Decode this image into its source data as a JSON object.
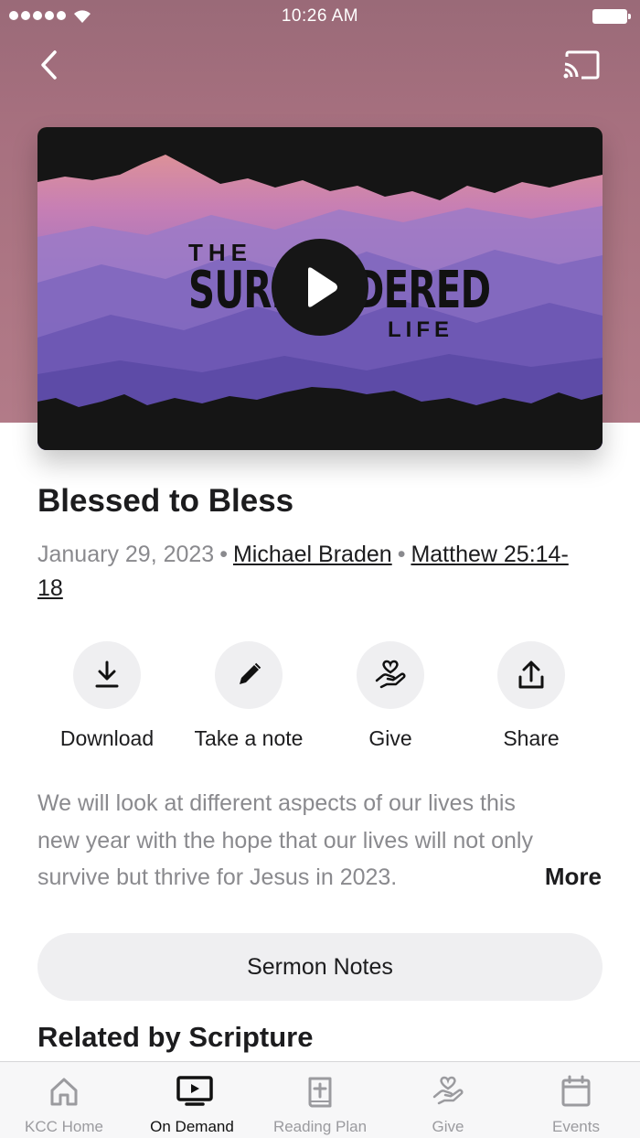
{
  "status_bar": {
    "time": "10:26 AM"
  },
  "nav": {
    "back_icon": "chevron-left-icon",
    "cast_icon": "cast-icon"
  },
  "video": {
    "artwork_title_top": "THE",
    "artwork_title_main": "SURRENDERED",
    "artwork_title_bottom": "LIFE",
    "play_icon": "play-icon"
  },
  "sermon": {
    "title": "Blessed to Bless",
    "date": "January 29, 2023",
    "speaker": "Michael Braden",
    "scripture": "Matthew 25:14-18",
    "description": "We will look at different aspects of our lives this new year with the hope that our lives will not only survive but thrive for Jesus in 2023.",
    "more_label": "More"
  },
  "actions": [
    {
      "label": "Download",
      "icon": "download-icon"
    },
    {
      "label": "Take a note",
      "icon": "pencil-icon"
    },
    {
      "label": "Give",
      "icon": "give-hand-heart-icon"
    },
    {
      "label": "Share",
      "icon": "share-icon"
    }
  ],
  "notes_button": {
    "label": "Sermon Notes"
  },
  "related": {
    "heading": "Related by Scripture"
  },
  "tab_bar": {
    "items": [
      {
        "label": "KCC Home",
        "icon": "home-icon",
        "active": false
      },
      {
        "label": "On Demand",
        "icon": "tv-play-icon",
        "active": true
      },
      {
        "label": "Reading Plan",
        "icon": "bible-icon",
        "active": false
      },
      {
        "label": "Give",
        "icon": "give-hand-heart-icon",
        "active": false
      },
      {
        "label": "Events",
        "icon": "calendar-icon",
        "active": false
      }
    ]
  },
  "colors": {
    "hero_background": "#a7707f",
    "accent_text": "#1c1c1e",
    "secondary_text": "#8a8a8e",
    "button_fill": "#efeff1"
  }
}
